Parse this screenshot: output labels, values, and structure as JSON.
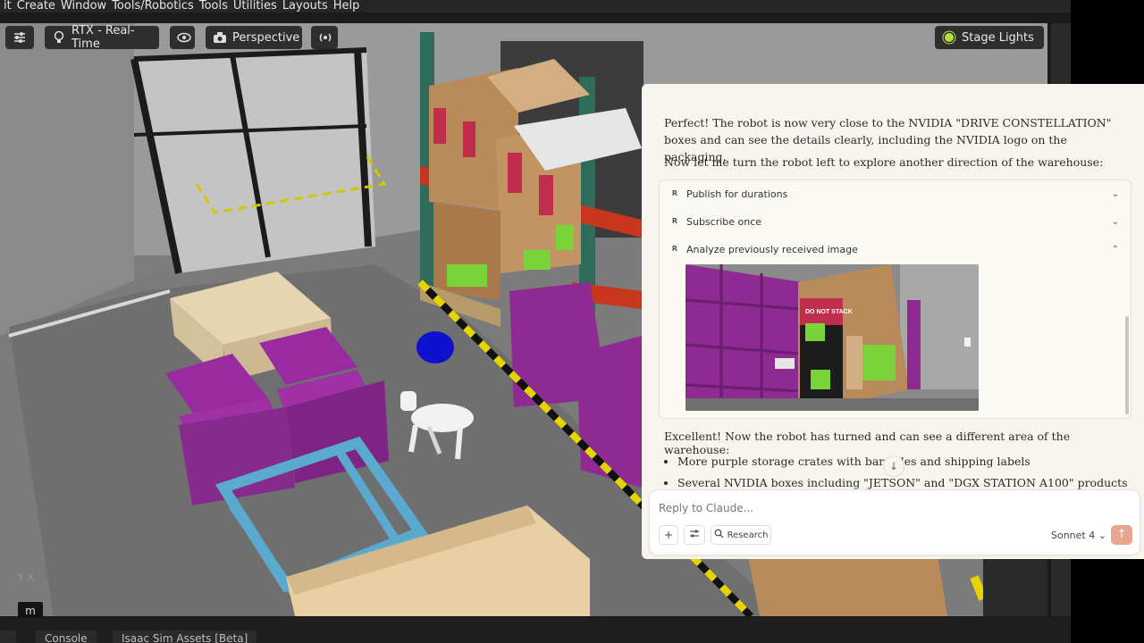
{
  "menu": [
    "it",
    "Create",
    "Window",
    "Tools/Robotics",
    "Tools",
    "Utilities",
    "Layouts",
    "Help"
  ],
  "toolbar": {
    "renderer": "RTX - Real-Time",
    "camera": "Perspective",
    "lights": "Stage Lights"
  },
  "viewport": {
    "key_hint": "m",
    "axis": "Y  X"
  },
  "bottom_tabs": [
    "Console",
    "Isaac Sim Assets [Beta]"
  ],
  "chat": {
    "message1": "Perfect! The robot is now very close to the NVIDIA \"DRIVE CONSTELLATION\" boxes and can see the details clearly, including the NVIDIA logo on the packaging.",
    "message2": "Now let me turn the robot left to explore another direction of the warehouse:",
    "tools": [
      {
        "badge": "R",
        "label": "Publish for durations",
        "chevron": "⌄"
      },
      {
        "badge": "R",
        "label": "Subscribe once",
        "chevron": "⌄"
      },
      {
        "badge": "R",
        "label": "Analyze previously received image",
        "chevron": "⌃"
      }
    ],
    "image_label": "DO NOT STACK",
    "message3": "Excellent! Now the robot has turned and can see a different area of the warehouse:",
    "bullets": [
      "More purple storage crates with barcodes and shipping labels",
      "Several NVIDIA boxes including \"JETSON\" and \"DGX STATION A100\" products"
    ],
    "input_placeholder": "Reply to Claude...",
    "research_label": "Research",
    "model_label": "Sonnet 4 ⌄",
    "send_icon": "↑",
    "scroll_icon": "↓"
  },
  "colors": {
    "crate_purple": "#8e2a92",
    "box_cardboard": "#b98a5a",
    "rack_green": "#2f6b5b",
    "marker_blue": "#1010d0",
    "send_button": "#e8a58f"
  }
}
